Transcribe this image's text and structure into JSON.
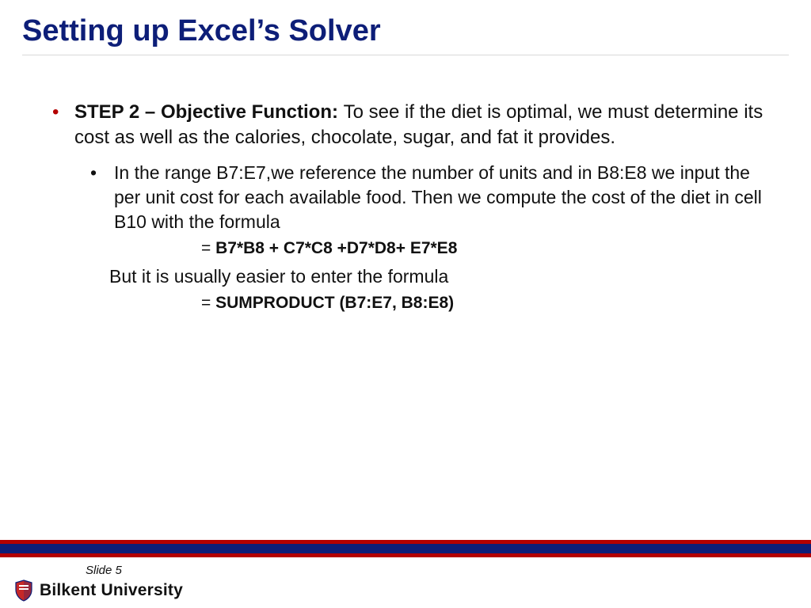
{
  "title": "Setting up Excel’s Solver",
  "bullet1": {
    "lead": "STEP 2 – Objective Function: ",
    "rest": "To see if the diet is optimal, we must determine its cost as well as the calories, chocolate, sugar, and fat it provides."
  },
  "bullet2": {
    "text": "In the range B7:E7,we reference the number of units and in B8:E8 we input the per unit cost for each available food. Then we compute the cost of the diet in cell B10 with the formula"
  },
  "formula1_eq": "= ",
  "formula1": "B7*B8 + C7*C8 +D7*D8+ E7*E8",
  "followup": "But it is usually easier to enter the formula",
  "formula2_eq": "= ",
  "formula2": "SUMPRODUCT (B7:E7, B8:E8)",
  "slide_label": "Slide ",
  "slide_number": "5",
  "university": "Bilkent University"
}
